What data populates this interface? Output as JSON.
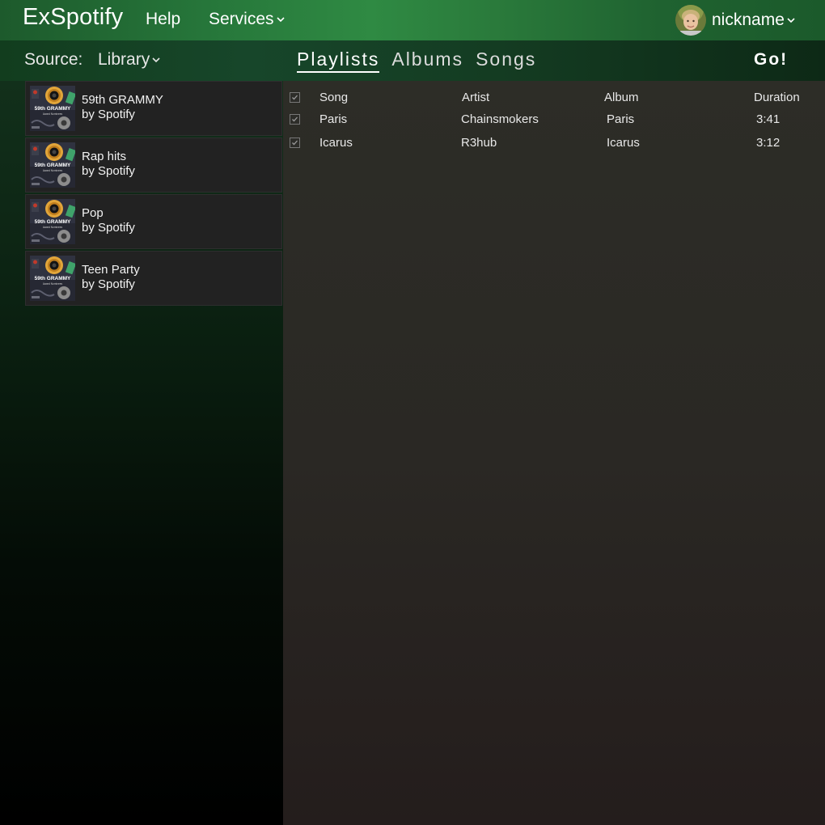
{
  "app": {
    "title": "ExSpotify"
  },
  "nav": {
    "help": "Help",
    "services": "Services"
  },
  "user": {
    "name": "nickname"
  },
  "source": {
    "label": "Source:",
    "value": "Library"
  },
  "tabs": [
    {
      "label": "Playlists",
      "active": true
    },
    {
      "label": "Albums",
      "active": false
    },
    {
      "label": "Songs",
      "active": false
    }
  ],
  "go": {
    "label": "Go!"
  },
  "playlists": [
    {
      "name": "59th GRAMMY",
      "owner": "by Spotify"
    },
    {
      "name": "Rap hits",
      "owner": "by Spotify"
    },
    {
      "name": "Pop",
      "owner": "by Spotify"
    },
    {
      "name": "Teen Party",
      "owner": "by Spotify"
    }
  ],
  "cover": {
    "title": "59th GRAMMY",
    "subtitle": "Award Nominees"
  },
  "songs_table": {
    "headers": {
      "song": "Song",
      "artist": "Artist",
      "album": "Album",
      "duration": "Duration"
    },
    "header_checked": true,
    "rows": [
      {
        "checked": true,
        "song": "Paris",
        "artist": "Chainsmokers",
        "album": "Paris",
        "duration": "3:41"
      },
      {
        "checked": true,
        "song": "Icarus",
        "artist": "R3hub",
        "album": "Icarus",
        "duration": "3:12"
      }
    ]
  },
  "colors": {
    "header_green": "#2f8a43",
    "panel_item": "#222222",
    "content_bg": "#2a2824"
  },
  "icons": [
    "chevron-down-icon",
    "avatar",
    "checkbox-checked-icon",
    "album-cover"
  ]
}
